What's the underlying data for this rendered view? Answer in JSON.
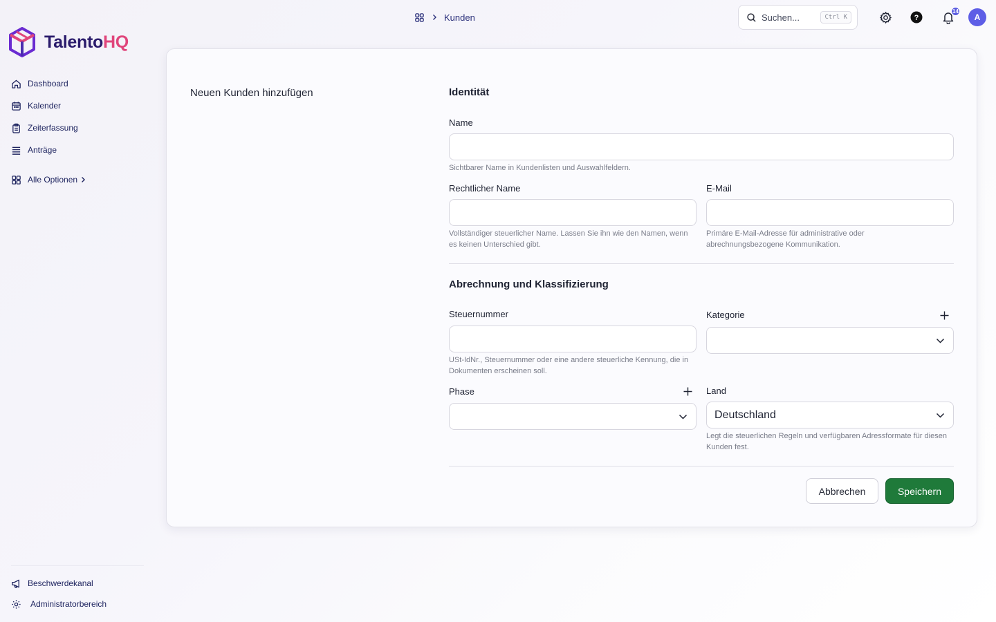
{
  "brand": {
    "name_part1": "Talento",
    "name_part2": "HQ"
  },
  "sidebar": {
    "items": [
      {
        "label": "Dashboard",
        "icon": "home-icon"
      },
      {
        "label": "Kalender",
        "icon": "calendar-icon"
      },
      {
        "label": "Zeiterfassung",
        "icon": "clipboard-icon"
      },
      {
        "label": "Anträge",
        "icon": "list-icon"
      }
    ],
    "all_options": {
      "label": "Alle Optionen",
      "icon": "grid-icon"
    },
    "bottom": [
      {
        "label": "Beschwerdekanal",
        "icon": "megaphone-icon"
      },
      {
        "label": "Administratorbereich",
        "icon": "gear-icon"
      }
    ]
  },
  "header": {
    "breadcrumb": {
      "current": "Kunden"
    },
    "search": {
      "placeholder": "Suchen...",
      "shortcut": "Ctrl K"
    },
    "notifications_count": "14",
    "avatar_initial": "A"
  },
  "form": {
    "title": "Neuen Kunden hinzufügen",
    "identity": {
      "heading": "Identität",
      "name_label": "Name",
      "name_value": "",
      "name_help": "Sichtbarer Name in Kundenlisten und Auswahlfeldern.",
      "legal_name_label": "Rechtlicher Name",
      "legal_name_value": "",
      "legal_name_help": "Vollständiger steuerlicher Name. Lassen Sie ihn wie den Namen, wenn es keinen Unterschied gibt.",
      "email_label": "E-Mail",
      "email_value": "",
      "email_help": "Primäre E-Mail-Adresse für administrative oder abrechnungsbezogene Kommunikation."
    },
    "billing": {
      "heading": "Abrechnung und Klassifizierung",
      "tax_label": "Steuernummer",
      "tax_value": "",
      "tax_help": "USt-IdNr., Steuernummer oder eine andere steuerliche Kennung, die in Dokumenten erscheinen soll.",
      "category_label": "Kategorie",
      "category_value": "",
      "phase_label": "Phase",
      "phase_value": "",
      "country_label": "Land",
      "country_value": "Deutschland",
      "country_help": "Legt die steuerlichen Regeln und verfügbaren Adressformate für diesen Kunden fest."
    },
    "actions": {
      "cancel": "Abbrechen",
      "save": "Speichern"
    }
  },
  "colors": {
    "accent": "#5e5ee6",
    "save_button": "#1f7a3a",
    "brand_dark": "#2a1b6b",
    "brand_pink": "#e0457b"
  }
}
